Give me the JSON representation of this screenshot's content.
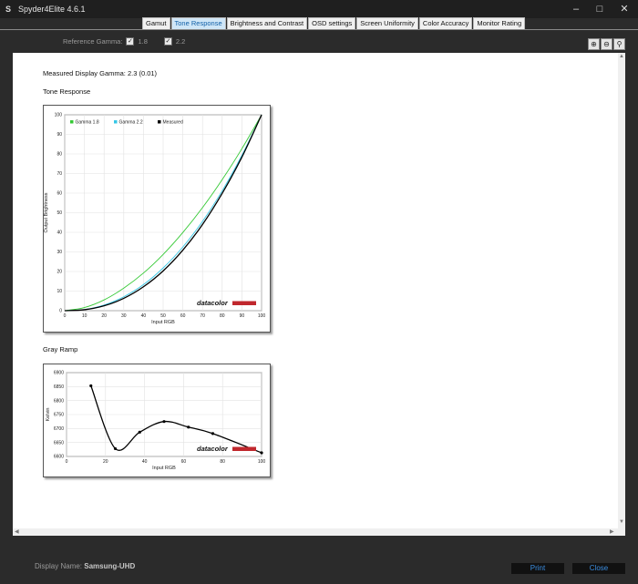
{
  "window": {
    "title": "Spyder4Elite 4.6.1",
    "icon_glyph": "S"
  },
  "tabs": [
    {
      "label": "Gamut",
      "active": false
    },
    {
      "label": "Tone Response",
      "active": true
    },
    {
      "label": "Brightness and Contrast",
      "active": false
    },
    {
      "label": "OSD settings",
      "active": false
    },
    {
      "label": "Screen Uniformity",
      "active": false
    },
    {
      "label": "Color Accuracy",
      "active": false
    },
    {
      "label": "Monitor Rating",
      "active": false
    }
  ],
  "reference": {
    "label": "Reference Gamma:",
    "option1": "1.8",
    "option2": "2.2",
    "option1_checked": true,
    "option2_checked": true
  },
  "content": {
    "measured_gamma": "Measured Display Gamma: 2.3 (0.01)",
    "tone_heading": "Tone Response",
    "gray_heading": "Gray Ramp"
  },
  "logo_text": "datacolor",
  "chart_data": [
    {
      "type": "line",
      "x": [
        0,
        10,
        20,
        30,
        40,
        50,
        60,
        70,
        80,
        90,
        100
      ],
      "series": [
        {
          "name": "Gamma 1.8",
          "color": "#35c935",
          "values": [
            0,
            1.6,
            5.5,
            11.5,
            19.2,
            28.7,
            39.9,
            52.6,
            66.9,
            82.7,
            100
          ]
        },
        {
          "name": "Gamma 2.2",
          "color": "#36c7e6",
          "values": [
            0,
            0.6,
            2.9,
            7.1,
            13.3,
            21.8,
            32.5,
            45.6,
            61.2,
            79.3,
            100
          ]
        },
        {
          "name": "Measured",
          "color": "#000000",
          "values": [
            0,
            0.5,
            2.5,
            6.3,
            12.2,
            20.3,
            30.9,
            44.0,
            59.9,
            78.4,
            100
          ]
        }
      ],
      "xlabel": "Input RGB",
      "ylabel": "Output Brightness",
      "xlim": [
        0,
        100
      ],
      "ylim": [
        0,
        100
      ],
      "xticks": [
        "0",
        "10",
        "20",
        "30",
        "40",
        "50",
        "60",
        "70",
        "80",
        "90",
        "100"
      ],
      "yticks": [
        "0",
        "10",
        "20",
        "30",
        "40",
        "50",
        "60",
        "70",
        "80",
        "90",
        "100"
      ],
      "grid": true,
      "legend": "top-left"
    },
    {
      "type": "line",
      "x": [
        12.5,
        25,
        37.5,
        50,
        62.5,
        75,
        100
      ],
      "series": [
        {
          "color": "#000000",
          "values": [
            6853,
            6628,
            6687,
            6725,
            6705,
            6682,
            6613
          ]
        }
      ],
      "xlabel": "Input RGB",
      "ylabel": "Kelvin",
      "xlim": [
        0,
        100
      ],
      "ylim": [
        6600,
        6900
      ],
      "xticks": [
        "0",
        "20",
        "40",
        "60",
        "80",
        "100"
      ],
      "yticks": [
        "6600",
        "6650",
        "6700",
        "6750",
        "6800",
        "6850",
        "6900"
      ],
      "grid": true
    }
  ],
  "footer": {
    "label": "Display Name:",
    "value": "Samsung-UHD",
    "print": "Print",
    "close": "Close"
  }
}
